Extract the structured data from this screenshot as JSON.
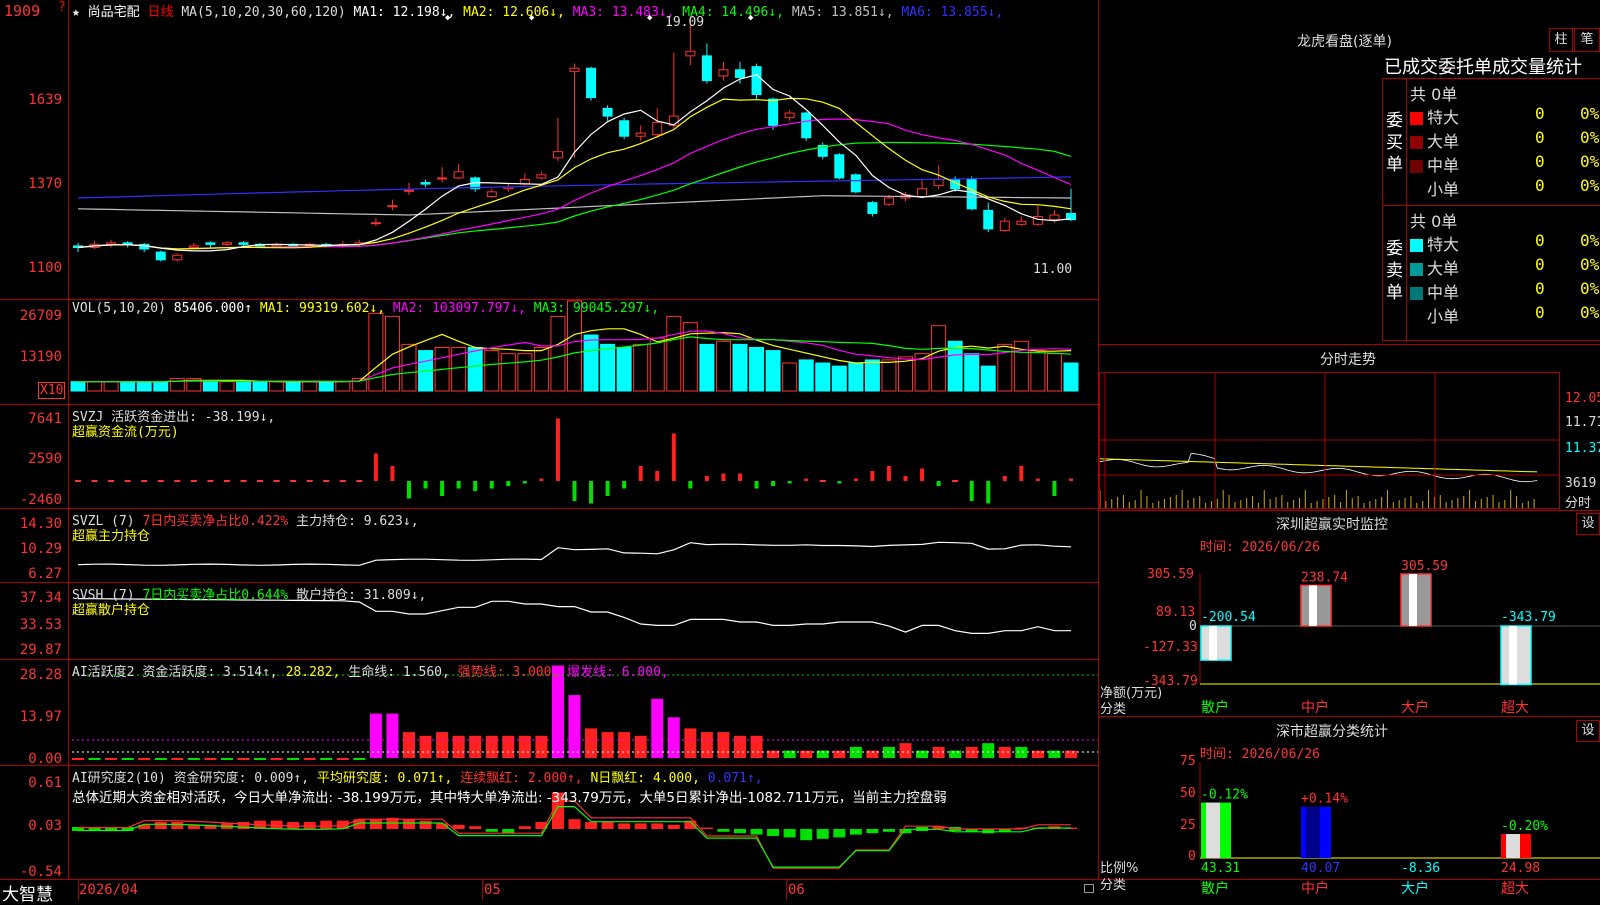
{
  "header": {
    "star": "★",
    "stock_name": "尚品宅配",
    "period": "日线",
    "ma_label": "MA(5,10,20,30,60,120)",
    "ma": [
      {
        "text": "MA1: 12.198↓",
        "color": "#ffffff"
      },
      {
        "text": "MA2: 12.606↓",
        "color": "#ffff00"
      },
      {
        "text": "MA3: 13.483↓",
        "color": "#ff00ff"
      },
      {
        "text": "MA4: 14.496↓",
        "color": "#00ff00"
      },
      {
        "text": "MA5: 13.851↓",
        "color": "#c0c0c0"
      },
      {
        "text": "MA6: 13.855↓",
        "color": "#3030ff"
      }
    ],
    "corner_mark": "?"
  },
  "price_panel": {
    "y_labels": [
      "1909",
      "1639",
      "1370",
      "1100"
    ],
    "high_label": "19.09",
    "low_label": "11.00",
    "markers": [
      "◆",
      "◆",
      "◆",
      "◆"
    ]
  },
  "vol_panel": {
    "info_label": "VOL(5,10,20)",
    "info_value": "85406.000↑",
    "ma": [
      {
        "text": "MA1: 99319.602↓",
        "color": "#ffff00"
      },
      {
        "text": "MA2: 103097.797↓",
        "color": "#ff00ff"
      },
      {
        "text": "MA3: 99045.297↓",
        "color": "#00ff00"
      }
    ],
    "y_labels": [
      "26709",
      "13190"
    ],
    "unit": "X10"
  },
  "svzj_panel": {
    "line1": "SVZJ  活跃资金进出: -38.199↓,",
    "line2": "超赢资金流(万元)",
    "y_labels": [
      "7641",
      "2590",
      "-2460"
    ]
  },
  "svzl_panel": {
    "line1_a": "SVZL (7)",
    "line1_b": "7日内买卖净占比0.422%",
    "line1_c": "主力持仓: 9.623↓,",
    "line2": "超赢主力持仓",
    "y_labels": [
      "14.30",
      "10.29",
      "6.27"
    ]
  },
  "svsh_panel": {
    "line1_a": "SVSH (7)",
    "line1_b": "7日内买卖净占比0.644%",
    "line1_c": "散户持仓: 31.809↓,",
    "line2": "超赢散户持仓",
    "y_labels": [
      "37.34",
      "33.53",
      "29.87"
    ]
  },
  "ai_panel": {
    "line1_a": "AI活跃度2",
    "line1_b": "资金活跃度: 3.514↑,",
    "line1_c": "28.282,",
    "line1_d": "生命线: 1.560,",
    "line1_e": "强势线: 3.000,",
    "line1_f": "爆发线: 6.000,",
    "y_labels": [
      "28.28",
      "13.97",
      "0.00"
    ]
  },
  "research_panel": {
    "line1_a": "AI研究度2(10)",
    "line1_b": "资金研究度: 0.009↑,",
    "line1_c": "平均研究度: 0.071↑,",
    "line1_d": "连续飘红: 2.000↑,",
    "line1_e": "N日飘红: 4.000,",
    "line1_f": "0.071↑,",
    "summary": "总体近期大资金相对活跃，今日大单净流出: -38.199万元，其中特大单净流出: -343.79万元，大单5日累计净出-1082.711万元，当前主力控盘弱",
    "y_labels": [
      "0.61",
      "0.03",
      "-0.54"
    ]
  },
  "bottom_bar": {
    "brand": "大智慧",
    "date_start": "2026/04",
    "month_05": "05",
    "month_06": "06"
  },
  "dragon_tiger": {
    "title": "龙虎看盘(逐单)",
    "btn_zhu": "柱",
    "btn_bi": "笔",
    "subtitle": "已成交委托单成交量统计",
    "buy_label": "委买单",
    "sell_label": "委卖单",
    "buy_total": "共 0单",
    "sell_total": "共 0单",
    "buy_rows": [
      {
        "label": "特大",
        "num": "0",
        "pct": "0%",
        "color": "#ff0000"
      },
      {
        "label": "大单",
        "num": "0",
        "pct": "0%",
        "color": "#900000"
      },
      {
        "label": "中单",
        "num": "0",
        "pct": "0%",
        "color": "#700000"
      },
      {
        "label": "小单",
        "num": "0",
        "pct": "0%",
        "color": "#000000"
      }
    ],
    "sell_rows": [
      {
        "label": "特大",
        "num": "0",
        "pct": "0%",
        "color": "#00ffff"
      },
      {
        "label": "大单",
        "num": "0",
        "pct": "0%",
        "color": "#009999"
      },
      {
        "label": "中单",
        "num": "0",
        "pct": "0%",
        "color": "#007777"
      },
      {
        "label": "小单",
        "num": "0",
        "pct": "0%",
        "color": "#000000"
      }
    ]
  },
  "intraday": {
    "title": "分时走势",
    "y_labels": [
      "12.05",
      "11.71",
      "11.37"
    ],
    "vol_label": "3619",
    "footer": "分时"
  },
  "sz_monitor": {
    "title": "深圳超赢实时监控",
    "btn": "设",
    "time": "时间: 2026/06/26",
    "y_labels": [
      "305.59",
      "89.13",
      "0",
      "-127.33",
      "-343.79"
    ],
    "axis_name": "净额(万元)",
    "category_axis": "分类"
  },
  "sz_stats": {
    "title": "深市超赢分类统计",
    "btn": "设",
    "time": "时间: 2026/06/26",
    "y_labels": [
      "75",
      "50",
      "25",
      "0"
    ],
    "axis_name": "比例%",
    "category_axis": "分类"
  },
  "chart_data": [
    {
      "type": "bar",
      "title": "深圳超赢实时监控",
      "ylabel": "净额(万元)",
      "xlabel": "分类",
      "categories": [
        "散户",
        "中户",
        "大户",
        "超大"
      ],
      "values": [
        -200.54,
        238.74,
        305.59,
        -343.79
      ],
      "ylim": [
        -343.79,
        305.59
      ]
    },
    {
      "type": "bar",
      "title": "深市超赢分类统计",
      "ylabel": "比例%",
      "xlabel": "分类",
      "categories": [
        "散户",
        "中户",
        "大户",
        "超大"
      ],
      "values": [
        43.31,
        40.07,
        -8.36,
        24.98
      ],
      "deltas": [
        "-0.12%",
        "+0.14%",
        "",
        "-0.20%"
      ],
      "ylim": [
        0,
        75
      ]
    }
  ]
}
